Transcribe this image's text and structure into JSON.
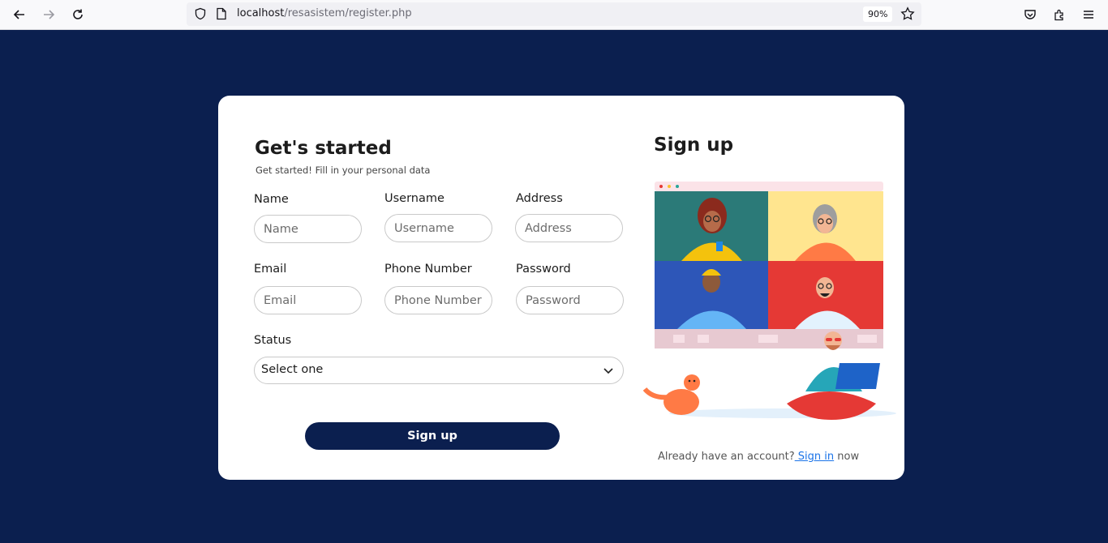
{
  "browser": {
    "url_host": "localhost",
    "url_path": "/resasistem/register.php",
    "zoom": "90%",
    "icons": [
      "back-icon",
      "forward-icon",
      "reload-icon",
      "shield-icon",
      "page-icon",
      "star-icon",
      "pocket-icon",
      "extensions-icon",
      "menu-icon"
    ]
  },
  "form": {
    "title": "Get's started",
    "subtitle": "Get started! Fill in your personal data",
    "fields": {
      "name": {
        "label": "Name",
        "placeholder": "Name"
      },
      "username": {
        "label": "Username",
        "placeholder": "Username"
      },
      "address": {
        "label": "Address",
        "placeholder": "Address"
      },
      "email": {
        "label": "Email",
        "placeholder": "Email"
      },
      "phone": {
        "label": "Phone Number",
        "placeholder": "Phone Number"
      },
      "password": {
        "label": "Password",
        "placeholder": "Password"
      }
    },
    "status": {
      "label": "Status",
      "selected": "Select one"
    },
    "submit_label": "Sign up"
  },
  "side": {
    "title": "Sign up",
    "footer_prefix": "Already have an account?",
    "signin_link": " Sign in",
    "footer_suffix": " now"
  },
  "colors": {
    "background": "#0b1f4f",
    "button": "#0b1f4f",
    "link": "#1a73e8"
  }
}
